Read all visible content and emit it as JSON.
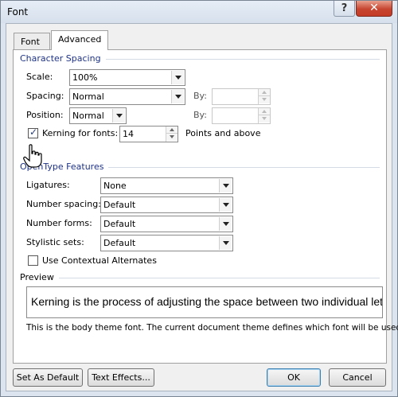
{
  "window": {
    "title": "Font"
  },
  "title_buttons": {
    "help": "?",
    "close": "✕"
  },
  "tabs": [
    {
      "label": "Font",
      "active": false
    },
    {
      "label": "Advanced",
      "active": true
    }
  ],
  "character_spacing": {
    "heading": "Character Spacing",
    "scale": {
      "label": "Scale:",
      "value": "100%"
    },
    "spacing": {
      "label": "Spacing:",
      "value": "Normal",
      "by_label": "By:",
      "by_value": ""
    },
    "position": {
      "label": "Position:",
      "value": "Normal",
      "by_label": "By:",
      "by_value": ""
    },
    "kerning": {
      "label": "Kerning for fonts:",
      "checked": true,
      "value": "14",
      "suffix": "Points and above"
    }
  },
  "opentype": {
    "heading": "OpenType Features",
    "ligatures": {
      "label": "Ligatures:",
      "value": "None"
    },
    "number_spacing": {
      "label": "Number spacing:",
      "value": "Default"
    },
    "number_forms": {
      "label": "Number forms:",
      "value": "Default"
    },
    "stylistic_sets": {
      "label": "Stylistic sets:",
      "value": "Default"
    },
    "contextual": {
      "label": "Use Contextual Alternates",
      "checked": false
    }
  },
  "preview": {
    "heading": "Preview",
    "text": "Kerning is the process of adjusting the space between two individual letters",
    "note": "This is the body theme font. The current document theme defines which font will be used."
  },
  "footer": {
    "set_default": "Set As Default",
    "text_effects": "Text Effects...",
    "ok": "OK",
    "cancel": "Cancel"
  },
  "colors": {
    "group_heading": "#1e3287",
    "accent": "#3c7fb1"
  },
  "icons": {
    "cursor": "hand-pointer-icon"
  }
}
